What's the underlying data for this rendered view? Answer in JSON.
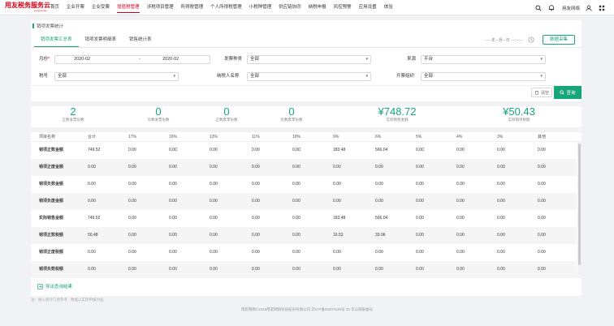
{
  "brand": {
    "name": "用友税务服务云",
    "tagline": "yonyou.com"
  },
  "nav": {
    "items": [
      "首页",
      "企业开票",
      "企业受票",
      "增值税管理",
      "涉税项目管理",
      "所得税管理",
      "个人所得税管理",
      "小税种管理",
      "供应链协同",
      "纳税申报",
      "风控预警",
      "应用设置",
      "体验"
    ],
    "active_index": 3,
    "company": "用友网络",
    "icons": [
      "search-icon",
      "bell-icon",
      "user-icon",
      "apps-icon"
    ]
  },
  "breadcrumb": "销项发票统计",
  "tabs": [
    {
      "label": "销项发票汇总表",
      "active": true
    },
    {
      "label": "销项发票明细表",
      "active": false
    },
    {
      "label": "销售统计表",
      "active": false
    }
  ],
  "toolbar": {
    "date_placeholder": "----年--月--日 --:--:--",
    "collect_label": "数据采集"
  },
  "filters": {
    "month": {
      "label": "月份",
      "required": "*",
      "from": "2020-02",
      "sep": "-",
      "to": "2020-02"
    },
    "invoice_type": {
      "label": "发票种类",
      "value": "全部"
    },
    "source": {
      "label": "来源",
      "value": "平台"
    },
    "tax_no": {
      "label": "税号",
      "value": "全部"
    },
    "taxpayer_name": {
      "label": "纳税人名称",
      "value": "全部"
    },
    "issuing_org": {
      "label": "开票组织",
      "value": "全部"
    },
    "clear_label": "清空",
    "query_label": "查询"
  },
  "stats": [
    {
      "value": "2",
      "label": "正数发票份数"
    },
    {
      "value": "0",
      "label": "负数发票份数"
    },
    {
      "value": "0",
      "label": "正数废票份数"
    },
    {
      "value": "0",
      "label": "负数废票份数"
    },
    {
      "value": "¥748.72",
      "label": "实际销售金额"
    },
    {
      "value": "¥50.43",
      "label": "实际销项税额"
    }
  ],
  "table": {
    "columns": [
      "项目名称",
      "合计",
      "17%",
      "16%",
      "13%",
      "11%",
      "10%",
      "9%",
      "6%",
      "5%",
      "4%",
      "3%",
      "其他"
    ],
    "rows": [
      [
        "销项正数金额",
        "749.52",
        "0.00",
        "0.00",
        "0.00",
        "0.00",
        "0.00",
        "183.48",
        "566.04",
        "0.00",
        "0.00",
        "0.00",
        "0.00"
      ],
      [
        "销项正废金额",
        "0.00",
        "0.00",
        "0.00",
        "0.00",
        "0.00",
        "0.00",
        "0.00",
        "0.00",
        "0.00",
        "0.00",
        "0.00",
        "0.00"
      ],
      [
        "销项负数金额",
        "0.00",
        "0.00",
        "0.00",
        "0.00",
        "0.00",
        "0.00",
        "0.00",
        "0.00",
        "0.00",
        "0.00",
        "0.00",
        "0.00"
      ],
      [
        "销项负废金额",
        "0.00",
        "0.00",
        "0.00",
        "0.00",
        "0.00",
        "0.00",
        "0.00",
        "0.00",
        "0.00",
        "0.00",
        "0.00",
        "0.00"
      ],
      [
        "实际销售金额",
        "749.52",
        "0.00",
        "0.00",
        "0.00",
        "0.00",
        "0.00",
        "183.48",
        "566.04",
        "0.00",
        "0.00",
        "0.00",
        "0.00"
      ],
      [
        "销项正数税额",
        "50.48",
        "0.00",
        "0.00",
        "0.00",
        "0.00",
        "0.00",
        "16.52",
        "33.96",
        "0.00",
        "0.00",
        "0.00",
        "0.00"
      ],
      [
        "销项正废税额",
        "0.00",
        "0.00",
        "0.00",
        "0.00",
        "0.00",
        "0.00",
        "0.00",
        "0.00",
        "0.00",
        "0.00",
        "0.00",
        "0.00"
      ],
      [
        "销项负数税额",
        "0.00",
        "0.00",
        "0.00",
        "0.00",
        "0.00",
        "0.00",
        "0.00",
        "0.00",
        "0.00",
        "0.00",
        "0.00",
        "0.00"
      ]
    ]
  },
  "export_label": "导出查询结果",
  "note": "注：纳入统计口径参考 · 数据以实际申报为准",
  "footer": "用友网络©2019用友网络科技股份有限公司  京ICP备05007539号-15  京公网安备号"
}
